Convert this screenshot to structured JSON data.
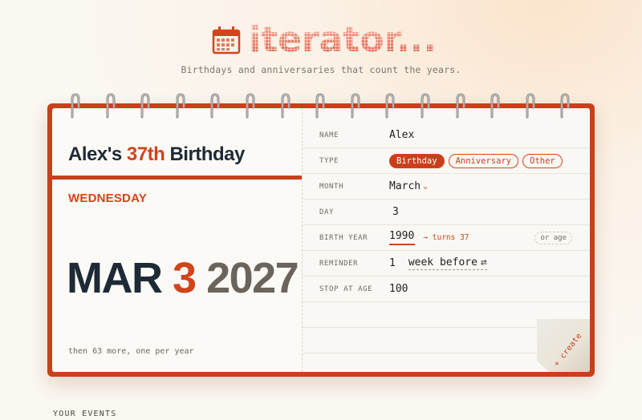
{
  "brand": {
    "name": "iterator...",
    "tagline": "Birthdays and anniversaries that count the years."
  },
  "preview": {
    "title_pre": "Alex's ",
    "title_num": "37th",
    "title_post": " Birthday",
    "weekday": "WEDNESDAY",
    "month": "MAR",
    "day": "3",
    "year": "2027",
    "footnote": "then 63 more, one per year"
  },
  "form": {
    "name_label": "NAME",
    "name_value": "Alex",
    "type_label": "TYPE",
    "types": [
      "Birthday",
      "Anniversary",
      "Other"
    ],
    "selected_type": "Birthday",
    "month_label": "MONTH",
    "month_value": "March",
    "day_label": "DAY",
    "day_value": "3",
    "birth_year_label": "BIRTH YEAR",
    "birth_year_value": "1990",
    "turns_text": "→ turns 37",
    "or_age_label": "or age",
    "reminder_label": "REMINDER",
    "reminder_value": "1",
    "reminder_unit": "week before",
    "stop_label": "STOP AT AGE",
    "stop_value": "100"
  },
  "create_label": "+ create",
  "your_events_label": "YOUR EVENTS",
  "colors": {
    "accent": "#c8401b",
    "ink": "#1e2a36",
    "muted": "#6b645c",
    "paper": "#fcfaf6"
  },
  "icons": {
    "brand": "calendar-icon",
    "swap": "swap-arrows-icon",
    "chevron": "chevron-down-icon"
  }
}
